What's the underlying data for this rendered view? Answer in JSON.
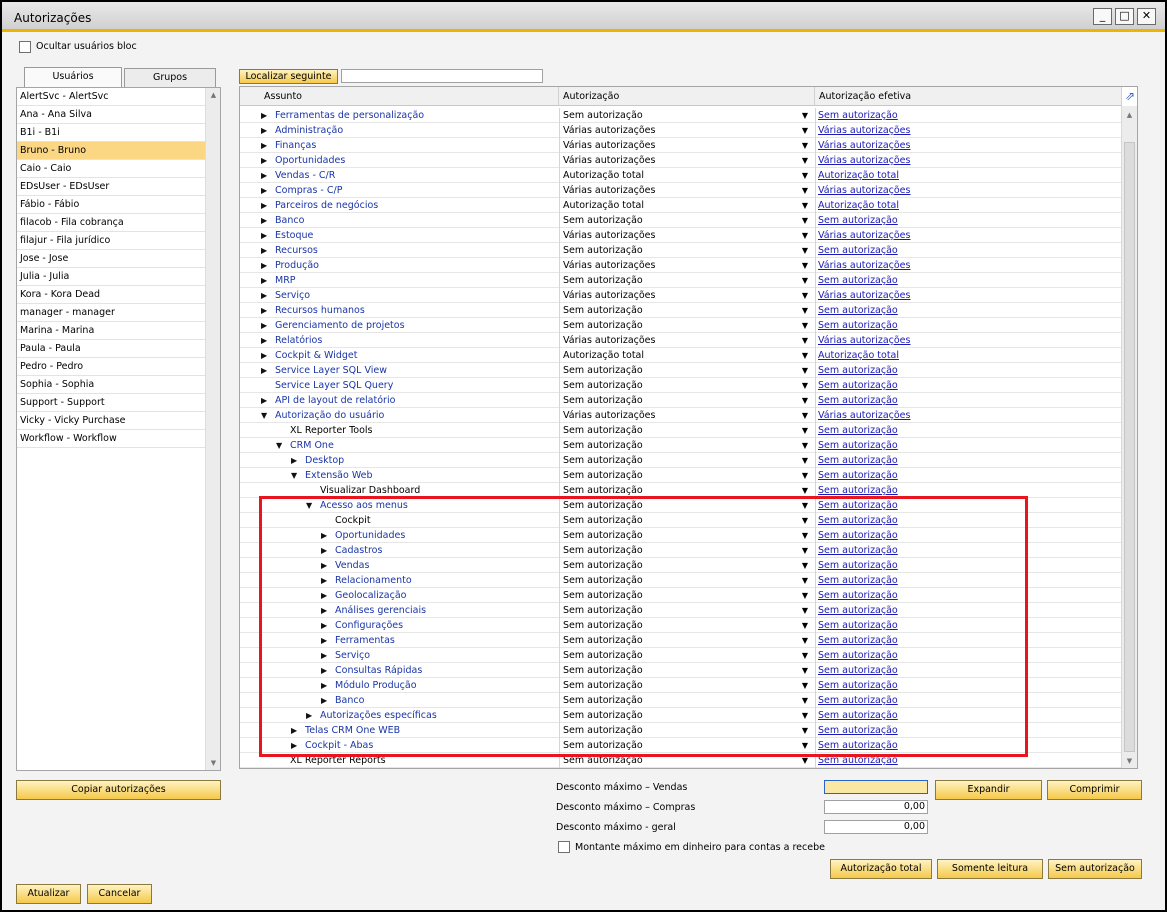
{
  "window": {
    "title": "Autorizações"
  },
  "hide_blocked_label": "Ocultar usuários bloc",
  "tabs": [
    "Usuários",
    "Grupos"
  ],
  "users": [
    "AlertSvc - AlertSvc",
    "Ana - Ana Silva",
    "B1i - B1i",
    "Bruno - Bruno",
    "Caio - Caio",
    "EDsUser - EDsUser",
    "Fábio - Fábio",
    "filacob - Fila cobrança",
    "filajur - Fila jurídico",
    "Jose - Jose",
    "Julia - Julia",
    "Kora - Kora Dead",
    "manager - manager",
    "Marina - Marina",
    "Paula - Paula",
    "Pedro - Pedro",
    "Sophia - Sophia",
    "Support - Support",
    "Vicky - Vicky Purchase",
    "Workflow - Workflow"
  ],
  "selected_user_index": 3,
  "find_next_label": "Localizar seguinte",
  "find_value": "",
  "columns": {
    "subject": "Assunto",
    "authorization": "Autorização",
    "effective": "Autorização efetiva"
  },
  "rows": [
    {
      "s": "Ferramentas de personalização",
      "a": "Sem autorização",
      "e": "Sem autorização",
      "lvl": 0,
      "t": "c",
      "link": true
    },
    {
      "s": "Administração",
      "a": "Várias autorizações",
      "e": "Várias autorizações",
      "lvl": 0,
      "t": "c",
      "link": true
    },
    {
      "s": "Finanças",
      "a": "Várias autorizações",
      "e": "Várias autorizações",
      "lvl": 0,
      "t": "c",
      "link": true
    },
    {
      "s": "Oportunidades",
      "a": "Várias autorizações",
      "e": "Várias autorizações",
      "lvl": 0,
      "t": "c",
      "link": true
    },
    {
      "s": "Vendas - C/R",
      "a": "Autorização total",
      "e": "Autorização total",
      "lvl": 0,
      "t": "c",
      "link": true
    },
    {
      "s": "Compras - C/P",
      "a": "Várias autorizações",
      "e": "Várias autorizações",
      "lvl": 0,
      "t": "c",
      "link": true
    },
    {
      "s": "Parceiros de negócios",
      "a": "Autorização total",
      "e": "Autorização total",
      "lvl": 0,
      "t": "c",
      "link": true
    },
    {
      "s": "Banco",
      "a": "Sem autorização",
      "e": "Sem autorização",
      "lvl": 0,
      "t": "c",
      "link": true
    },
    {
      "s": "Estoque",
      "a": "Várias autorizações",
      "e": "Várias autorizações",
      "lvl": 0,
      "t": "c",
      "link": true
    },
    {
      "s": "Recursos",
      "a": "Sem autorização",
      "e": "Sem autorização",
      "lvl": 0,
      "t": "c",
      "link": true
    },
    {
      "s": "Produção",
      "a": "Várias autorizações",
      "e": "Várias autorizações",
      "lvl": 0,
      "t": "c",
      "link": true
    },
    {
      "s": "MRP",
      "a": "Sem autorização",
      "e": "Sem autorização",
      "lvl": 0,
      "t": "c",
      "link": true
    },
    {
      "s": "Serviço",
      "a": "Várias autorizações",
      "e": "Várias autorizações",
      "lvl": 0,
      "t": "c",
      "link": true
    },
    {
      "s": "Recursos humanos",
      "a": "Sem autorização",
      "e": "Sem autorização",
      "lvl": 0,
      "t": "c",
      "link": true
    },
    {
      "s": "Gerenciamento de projetos",
      "a": "Sem autorização",
      "e": "Sem autorização",
      "lvl": 0,
      "t": "c",
      "link": true
    },
    {
      "s": "Relatórios",
      "a": "Várias autorizações",
      "e": "Várias autorizações",
      "lvl": 0,
      "t": "c",
      "link": true
    },
    {
      "s": "Cockpit & Widget",
      "a": "Autorização total",
      "e": "Autorização total",
      "lvl": 0,
      "t": "c",
      "link": true
    },
    {
      "s": "Service Layer SQL View",
      "a": "Sem autorização",
      "e": "Sem autorização",
      "lvl": 0,
      "t": "c",
      "link": true
    },
    {
      "s": "Service Layer SQL Query",
      "a": "Sem autorização",
      "e": "Sem autorização",
      "lvl": 0,
      "t": "n",
      "link": true
    },
    {
      "s": "API de layout de relatório",
      "a": "Sem autorização",
      "e": "Sem autorização",
      "lvl": 0,
      "t": "c",
      "link": true
    },
    {
      "s": "Autorização do usuário",
      "a": "Várias autorizações",
      "e": "Várias autorizações",
      "lvl": 0,
      "t": "e",
      "link": true
    },
    {
      "s": "XL Reporter Tools",
      "a": "Sem autorização",
      "e": "Sem autorização",
      "lvl": 1,
      "t": "n",
      "link": false
    },
    {
      "s": "CRM One",
      "a": "Sem autorização",
      "e": "Sem autorização",
      "lvl": 1,
      "t": "e",
      "link": true
    },
    {
      "s": "Desktop",
      "a": "Sem autorização",
      "e": "Sem autorização",
      "lvl": 2,
      "t": "c",
      "link": true
    },
    {
      "s": "Extensão Web",
      "a": "Sem autorização",
      "e": "Sem autorização",
      "lvl": 2,
      "t": "e",
      "link": true
    },
    {
      "s": "Visualizar Dashboard",
      "a": "Sem autorização",
      "e": "Sem autorização",
      "lvl": 3,
      "t": "n",
      "link": false
    },
    {
      "s": "Acesso aos menus",
      "a": "Sem autorização",
      "e": "Sem autorização",
      "lvl": 3,
      "t": "e",
      "link": true
    },
    {
      "s": "Cockpit",
      "a": "Sem autorização",
      "e": "Sem autorização",
      "lvl": 4,
      "t": "n",
      "link": false
    },
    {
      "s": "Oportunidades",
      "a": "Sem autorização",
      "e": "Sem autorização",
      "lvl": 4,
      "t": "c",
      "link": true
    },
    {
      "s": "Cadastros",
      "a": "Sem autorização",
      "e": "Sem autorização",
      "lvl": 4,
      "t": "c",
      "link": true
    },
    {
      "s": "Vendas",
      "a": "Sem autorização",
      "e": "Sem autorização",
      "lvl": 4,
      "t": "c",
      "link": true
    },
    {
      "s": "Relacionamento",
      "a": "Sem autorização",
      "e": "Sem autorização",
      "lvl": 4,
      "t": "c",
      "link": true
    },
    {
      "s": "Geolocalização",
      "a": "Sem autorização",
      "e": "Sem autorização",
      "lvl": 4,
      "t": "c",
      "link": true
    },
    {
      "s": "Análises gerenciais",
      "a": "Sem autorização",
      "e": "Sem autorização",
      "lvl": 4,
      "t": "c",
      "link": true
    },
    {
      "s": "Configurações",
      "a": "Sem autorização",
      "e": "Sem autorização",
      "lvl": 4,
      "t": "c",
      "link": true
    },
    {
      "s": "Ferramentas",
      "a": "Sem autorização",
      "e": "Sem autorização",
      "lvl": 4,
      "t": "c",
      "link": true
    },
    {
      "s": "Serviço",
      "a": "Sem autorização",
      "e": "Sem autorização",
      "lvl": 4,
      "t": "c",
      "link": true
    },
    {
      "s": "Consultas Rápidas",
      "a": "Sem autorização",
      "e": "Sem autorização",
      "lvl": 4,
      "t": "c",
      "link": true
    },
    {
      "s": "Módulo Produção",
      "a": "Sem autorização",
      "e": "Sem autorização",
      "lvl": 4,
      "t": "c",
      "link": true
    },
    {
      "s": "Banco",
      "a": "Sem autorização",
      "e": "Sem autorização",
      "lvl": 4,
      "t": "c",
      "link": true
    },
    {
      "s": "Autorizações específicas",
      "a": "Sem autorização",
      "e": "Sem autorização",
      "lvl": 3,
      "t": "c",
      "link": true
    },
    {
      "s": "Telas CRM One WEB",
      "a": "Sem autorização",
      "e": "Sem autorização",
      "lvl": 2,
      "t": "c",
      "link": true
    },
    {
      "s": "Cockpit - Abas",
      "a": "Sem autorização",
      "e": "Sem autorização",
      "lvl": 2,
      "t": "c",
      "link": true
    },
    {
      "s": "XL Reporter Reports",
      "a": "Sem autorização",
      "e": "Sem autorização",
      "lvl": 1,
      "t": "n",
      "link": false
    }
  ],
  "discounts": {
    "sales_label": "Desconto máximo – Vendas",
    "sales_value": "",
    "purchases_label": "Desconto máximo – Compras",
    "purchases_value": "0,00",
    "general_label": "Desconto máximo - geral",
    "general_value": "0,00",
    "cash_label": "Montante máximo em dinheiro para contas a recebe"
  },
  "buttons": {
    "expand": "Expandir",
    "collapse": "Comprimir",
    "copy": "Copiar autorizações",
    "full": "Autorização total",
    "readonly": "Somente leitura",
    "none": "Sem autorização",
    "update": "Atualizar",
    "cancel": "Cancelar"
  }
}
